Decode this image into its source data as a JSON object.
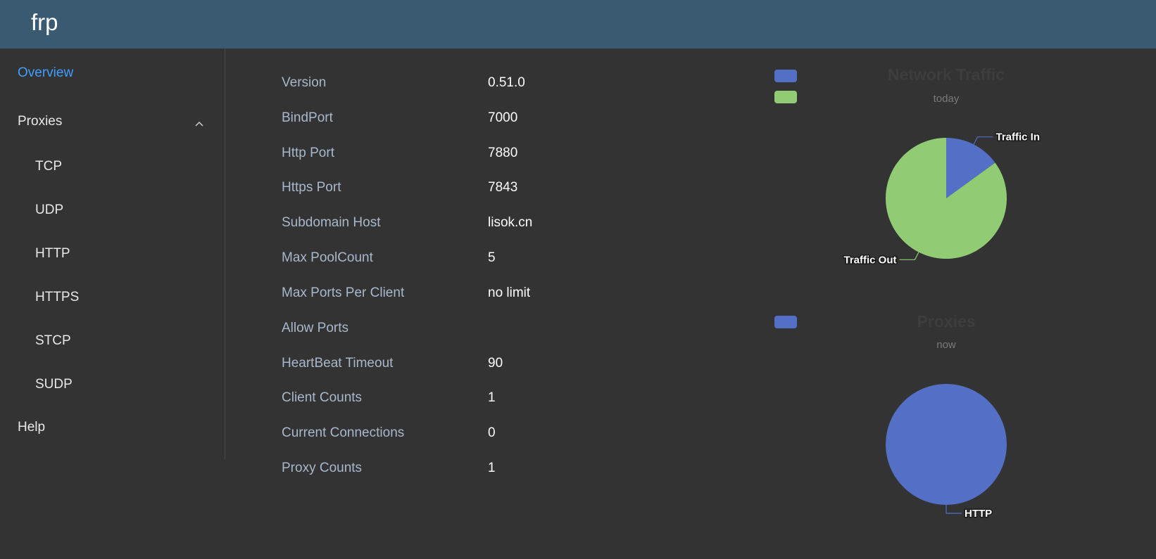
{
  "app": {
    "title": "frp"
  },
  "sidebar": {
    "overview": "Overview",
    "proxies": "Proxies",
    "sub_items": [
      "TCP",
      "UDP",
      "HTTP",
      "HTTPS",
      "STCP",
      "SUDP"
    ],
    "help": "Help"
  },
  "server_info": [
    {
      "label": "Version",
      "value": "0.51.0"
    },
    {
      "label": "BindPort",
      "value": "7000"
    },
    {
      "label": "Http Port",
      "value": "7880"
    },
    {
      "label": "Https Port",
      "value": "7843"
    },
    {
      "label": "Subdomain Host",
      "value": "lisok.cn"
    },
    {
      "label": "Max PoolCount",
      "value": "5"
    },
    {
      "label": "Max Ports Per Client",
      "value": "no limit"
    },
    {
      "label": "Allow Ports",
      "value": ""
    },
    {
      "label": "HeartBeat Timeout",
      "value": "90"
    },
    {
      "label": "Client Counts",
      "value": "1"
    },
    {
      "label": "Current Connections",
      "value": "0"
    },
    {
      "label": "Proxy Counts",
      "value": "1"
    }
  ],
  "colors": {
    "blue": "#5470c6",
    "green": "#91cc75",
    "active": "#409eff"
  },
  "chart_data": [
    {
      "type": "pie",
      "title": "Network Traffic",
      "subtitle": "today",
      "slices": [
        {
          "name": "Traffic In",
          "value": 15,
          "color": "#5470c6"
        },
        {
          "name": "Traffic Out",
          "value": 85,
          "color": "#91cc75"
        }
      ]
    },
    {
      "type": "pie",
      "title": "Proxies",
      "subtitle": "now",
      "slices": [
        {
          "name": "HTTP",
          "value": 1,
          "color": "#5470c6"
        }
      ]
    }
  ]
}
